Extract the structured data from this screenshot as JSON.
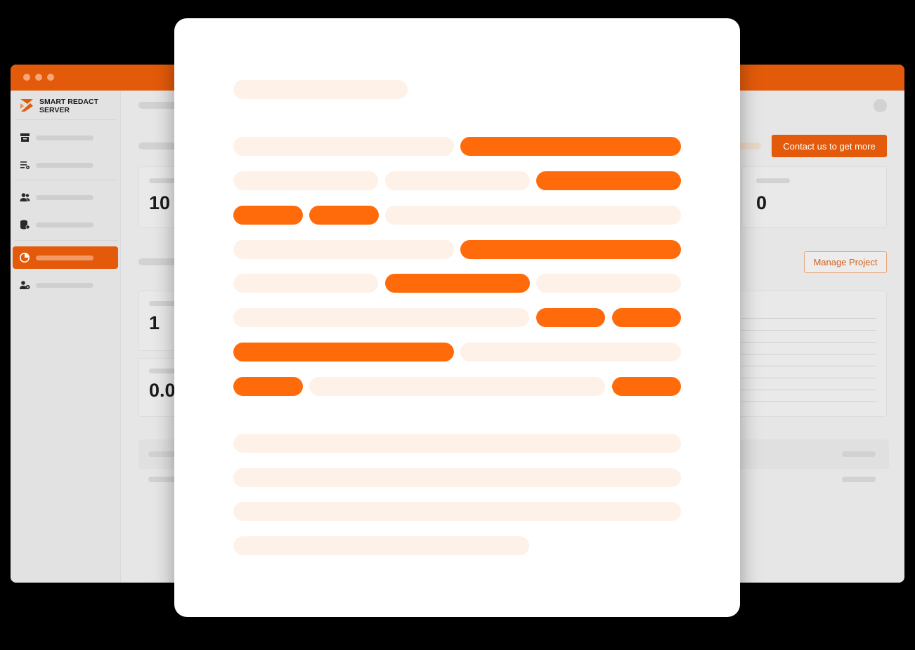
{
  "app": {
    "brand": "SMART REDACT SERVER",
    "brand_icon": "redact-logo-icon",
    "accent_color": "#e35a0a",
    "sidebar": {
      "items": [
        {
          "icon": "archive-box-icon",
          "active": false
        },
        {
          "icon": "list-settings-icon",
          "active": false
        },
        {
          "icon": "users-icon",
          "active": false
        },
        {
          "icon": "database-settings-icon",
          "active": false
        },
        {
          "icon": "pie-chart-icon",
          "active": true
        },
        {
          "icon": "user-settings-icon",
          "active": false
        }
      ]
    },
    "buttons": {
      "contact_label": "Contact us to get more",
      "manage_label": "Manage Project"
    },
    "stats": {
      "card_1_value": "10 1",
      "card_2_value": "0",
      "card_3_value": "1",
      "card_4_value": "0.0"
    }
  },
  "document": {
    "redaction_color": "#ff6a0a",
    "text_color": "#fef1e7"
  }
}
